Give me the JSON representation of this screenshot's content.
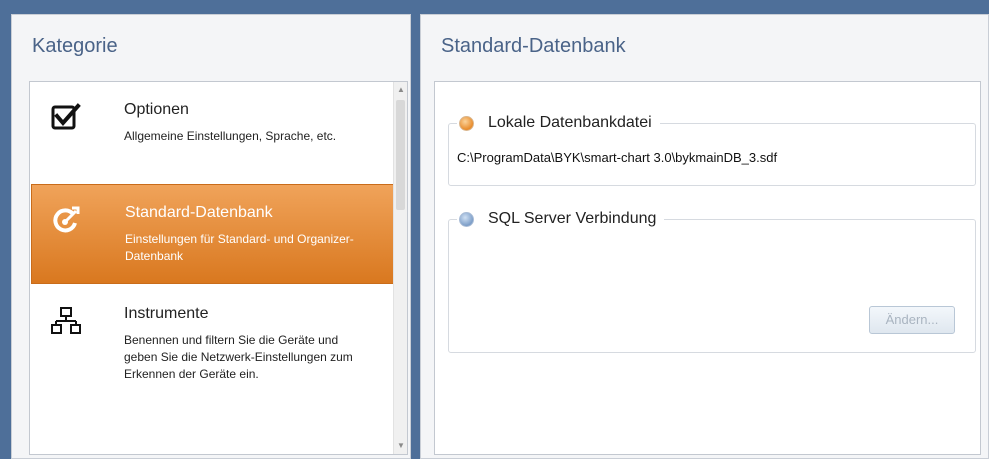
{
  "category_panel": {
    "title": "Kategorie",
    "items": [
      {
        "icon": "checkbox-checked-icon",
        "title": "Optionen",
        "description": "Allgemeine Einstellungen, Sprache, etc.",
        "selected": false
      },
      {
        "icon": "database-target-icon",
        "title": "Standard-Datenbank",
        "description": "Einstellungen für Standard- und Organizer-Datenbank",
        "selected": true
      },
      {
        "icon": "network-icon",
        "title": "Instrumente",
        "description": "Benennen und filtern Sie die Geräte und geben Sie die Netzwerk-Einstellungen zum Erkennen der Geräte ein.",
        "selected": false
      }
    ]
  },
  "database_panel": {
    "title": "Standard-Datenbank",
    "local": {
      "label": "Lokale Datenbankdatei",
      "path": "C:\\ProgramData\\BYK\\smart-chart 3.0\\bykmainDB_3.sdf",
      "selected": true
    },
    "sql": {
      "label": "SQL Server Verbindung",
      "selected": false,
      "change_button": "Ändern..."
    }
  },
  "colors": {
    "background": "#4e6f99",
    "title_text": "#4a6388",
    "selected_item": "#e08a34"
  }
}
